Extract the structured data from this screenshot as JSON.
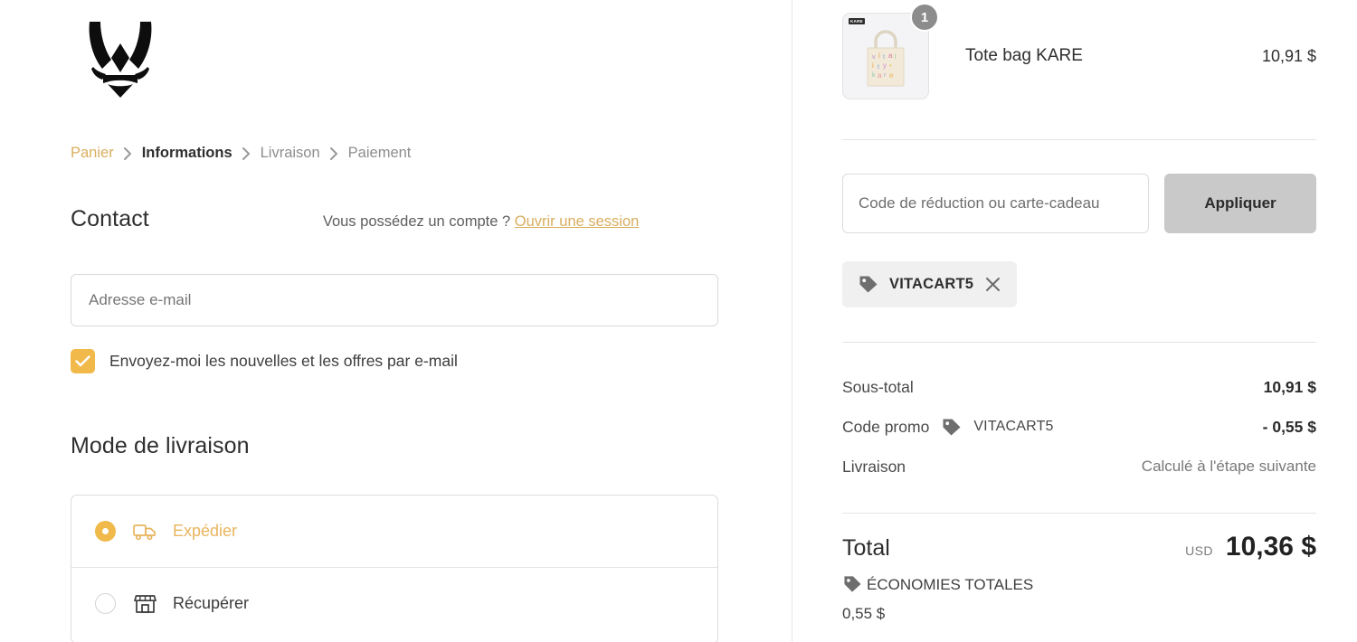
{
  "brand": {
    "logo_name": "vitality-bee-logo"
  },
  "breadcrumb": {
    "items": [
      {
        "label": "Panier",
        "state": "done"
      },
      {
        "label": "Informations",
        "state": "active"
      },
      {
        "label": "Livraison",
        "state": "todo"
      },
      {
        "label": "Paiement",
        "state": "todo"
      }
    ]
  },
  "contact": {
    "title": "Contact",
    "account_question": "Vous possédez un compte ?",
    "login_link": "Ouvrir une session",
    "email_placeholder": "Adresse e-mail",
    "email_value": "",
    "newsletter_label": "Envoyez-moi les nouvelles et les offres par e-mail",
    "newsletter_checked": true
  },
  "delivery": {
    "title": "Mode de livraison",
    "options": [
      {
        "label": "Expédier",
        "icon": "truck-icon",
        "selected": true
      },
      {
        "label": "Récupérer",
        "icon": "store-icon",
        "selected": false
      }
    ]
  },
  "summary": {
    "product": {
      "name": "Tote bag KARE",
      "price": "10,91 $",
      "quantity": "1",
      "thumb_brand": "KARE"
    },
    "promo": {
      "input_placeholder": "Code de réduction ou carte-cadeau",
      "input_value": "",
      "apply_label": "Appliquer",
      "applied_code": "VITACART5"
    },
    "lines": [
      {
        "label": "Sous-total",
        "code": "",
        "value": "10,91 $",
        "muted": false
      },
      {
        "label": "Code promo",
        "code": "VITACART5",
        "value": "- 0,55 $",
        "muted": false
      },
      {
        "label": "Livraison",
        "code": "",
        "value": "Calculé à l'étape suivante",
        "muted": true
      }
    ],
    "total": {
      "label": "Total",
      "currency": "USD",
      "amount": "10,36 $",
      "savings_label": "ÉCONOMIES TOTALES",
      "savings_amount": "0,55 $"
    }
  },
  "colors": {
    "accent_gold": "#f0b94a",
    "link_gold": "#d9ae5e",
    "button_gray": "#c9c9c9",
    "badge_gray": "#8c8c8c",
    "text_dark": "#2f2f2f"
  }
}
